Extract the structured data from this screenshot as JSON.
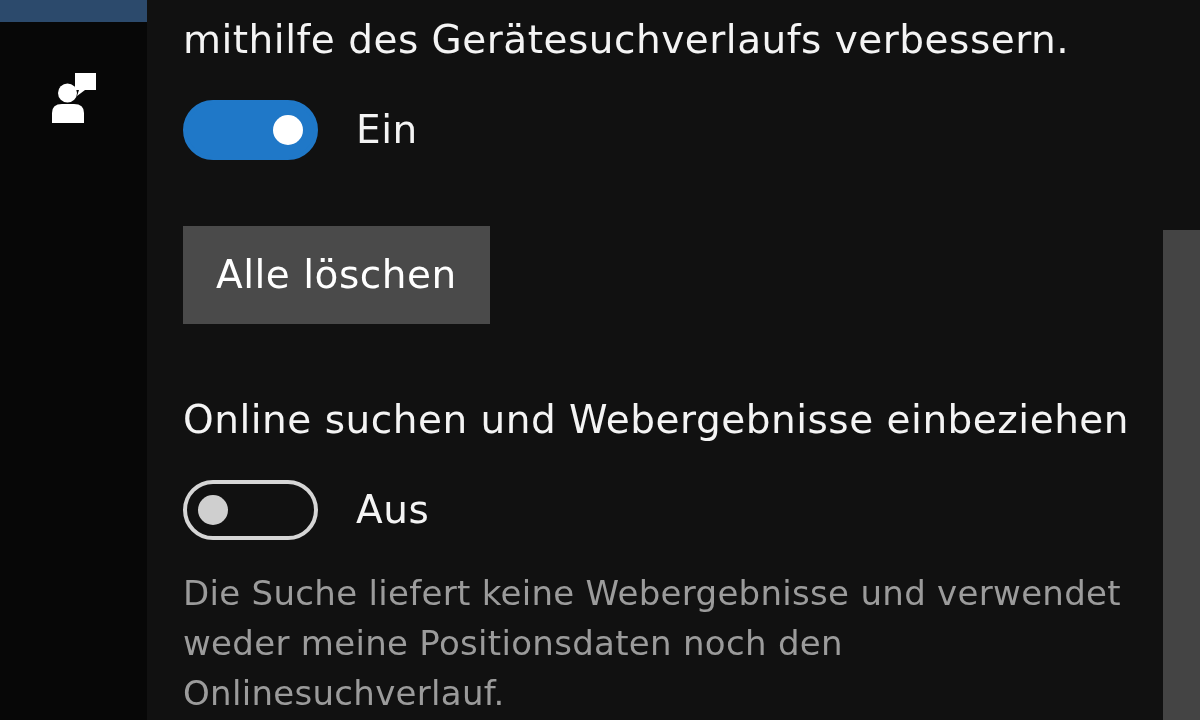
{
  "sidebar": {
    "items": [
      {
        "kind": "clipped",
        "selected": true
      },
      {
        "kind": "icon",
        "selected": false
      }
    ]
  },
  "settings": [
    {
      "kind": "text",
      "text": "mithilfe des Gerätesuchverlaufs verbessern."
    },
    {
      "kind": "toggle",
      "on": true,
      "label": "Ein"
    },
    {
      "kind": "button",
      "label": "Alle löschen"
    },
    {
      "kind": "heading",
      "text": "Online suchen und Webergebnisse einbeziehen"
    },
    {
      "kind": "toggle",
      "on": false,
      "label": "Aus"
    },
    {
      "kind": "description",
      "text": "Die Suche liefert keine Webergebnisse und verwendet weder meine Positionsdaten noch den Onlinesuchverlauf."
    }
  ]
}
